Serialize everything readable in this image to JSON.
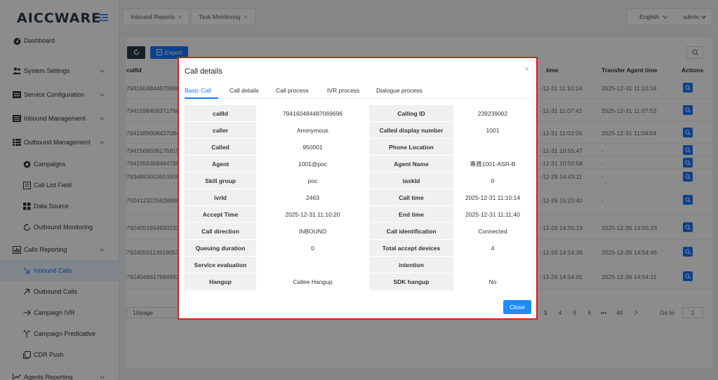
{
  "brand": {
    "logo": "AICCWARE"
  },
  "sidebar": {
    "items": [
      {
        "label": "Dashboard"
      },
      {
        "label": "System Settings"
      },
      {
        "label": "Service Configuration"
      },
      {
        "label": "Inbound Management"
      },
      {
        "label": "Outbound Management"
      },
      {
        "label": "Campaigns"
      },
      {
        "label": "Call List Field"
      },
      {
        "label": "Data Source"
      },
      {
        "label": "Outbound Monitoring"
      },
      {
        "label": "Calls Reporting"
      },
      {
        "label": "Inbound Calls"
      },
      {
        "label": "Outbound Calls"
      },
      {
        "label": "Campaign IVR"
      },
      {
        "label": "Campaign Predicative"
      },
      {
        "label": "CDR Push"
      },
      {
        "label": "Agents Reporting"
      }
    ]
  },
  "topbar": {
    "tabs": [
      {
        "label": "Inbound Reports"
      },
      {
        "label": "Task Monitoring"
      }
    ],
    "language": "English",
    "user": "admin"
  },
  "toolbar": {
    "export_label": "Export"
  },
  "table": {
    "headers": {
      "callid": "callId",
      "time": "time",
      "transfer": "Transfer Agent time",
      "actions": "Actions"
    },
    "rows": [
      {
        "callid": "7941604844870696",
        "time": "-12-31 11:10:14",
        "transfer": "2025-12-31 11:10:16"
      },
      {
        "callid": "7941598458371768",
        "time": "-12-31 11:07:42",
        "transfer": "2025-12-31 11:07:53"
      },
      {
        "callid": "7941589008437084",
        "time": "-12-31 11:03:56",
        "transfer": "2025-12-31 11:04:04"
      },
      {
        "callid": "7941568506175815",
        "time": "-12-31 10:55:47",
        "transfer": "-"
      },
      {
        "callid": "7941556358464798",
        "time": "-12-31 10:50:58",
        "transfer": "-"
      },
      {
        "callid": "7934893003553505",
        "time": "-12-29 14:43:11",
        "transfer": "-"
      },
      {
        "callid": "7924123225628990",
        "time": "-12-26 15:23:40",
        "transfer": "-"
      },
      {
        "callid": "7924051654990233",
        "time": "-12-26 14:55:13",
        "transfer": "2025-12-26 14:55:33"
      },
      {
        "callid": "7924050113919057",
        "time": "-12-26 14:54:36",
        "transfer": "2025-12-26 14:54:46"
      },
      {
        "callid": "7924048617684992",
        "time": "-12-26 14:54:01",
        "transfer": "2025-12-26 14:54:11"
      }
    ]
  },
  "pagination": {
    "page_size": "10/page",
    "pages": [
      "3",
      "4",
      "5",
      "6"
    ],
    "ellipsis": "•••",
    "last_page": "40",
    "goto_label": "Go to",
    "goto_value": "1"
  },
  "modal": {
    "title": "Call details",
    "close_x": "×",
    "tabs": [
      {
        "label": "Basic Call"
      },
      {
        "label": "Call details"
      },
      {
        "label": "Call process"
      },
      {
        "label": "IVR process"
      },
      {
        "label": "Dialogue process"
      }
    ],
    "rows": [
      {
        "l1": "callId",
        "v1": "794160484487069696",
        "l2": "Calling ID",
        "v2": "239239002"
      },
      {
        "l1": "caller",
        "v1": "Anonymous",
        "l2": "Called display number",
        "v2": "1001"
      },
      {
        "l1": "Called",
        "v1": "950001",
        "l2": "Phone Location",
        "v2": ""
      },
      {
        "l1": "Agent",
        "v1": "1001@poc",
        "l2": "Agent Name",
        "v2": "專員1001-ASR-B"
      },
      {
        "l1": "Skill group",
        "v1": "poc",
        "l2": "taskId",
        "v2": "0"
      },
      {
        "l1": "ivrId",
        "v1": "2463",
        "l2": "Call time",
        "v2": "2025-12-31 11:10:14"
      },
      {
        "l1": "Accept Time",
        "v1": "2025-12-31 11:10:20",
        "l2": "End time",
        "v2": "2025-12-31 11:11:40"
      },
      {
        "l1": "Call direction",
        "v1": "INBOUND",
        "l2": "Call identification",
        "v2": "Connected"
      },
      {
        "l1": "Queuing duration",
        "v1": "0",
        "l2": "Total accept devices",
        "v2": "4"
      },
      {
        "l1": "Service evaluation",
        "v1": "",
        "l2": "intention",
        "v2": ""
      },
      {
        "l1": "Hangup",
        "v1": "Callee Hangup",
        "l2": "SDK hangup",
        "v2": "No"
      },
      {
        "l1": "",
        "v1": "",
        "l2": "",
        "v2": ""
      }
    ],
    "close_label": "Close"
  },
  "colors": {
    "primary": "#1677ff",
    "highlight": "#e11c1c",
    "dark_button": "#2b3a4a"
  }
}
